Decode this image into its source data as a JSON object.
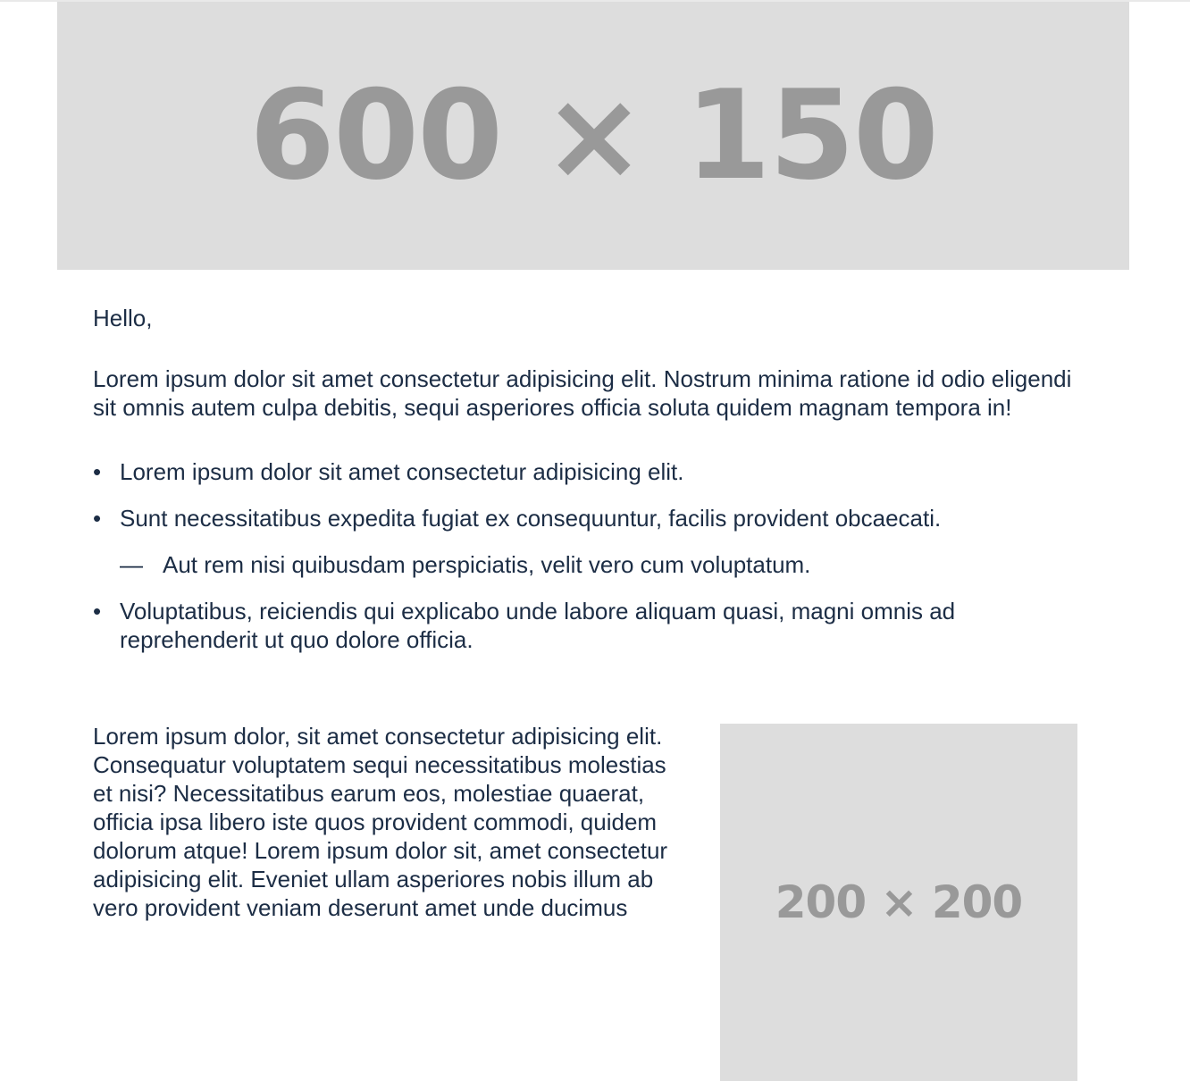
{
  "hero_image": {
    "placeholder_text": "600 × 150"
  },
  "email": {
    "greeting": "Hello,",
    "intro": "Lorem ipsum dolor sit amet consectetur adipisicing elit. Nostrum minima ratione id odio eligendi sit omnis autem culpa debitis, sequi asperiores officia soluta quidem magnam tempora in!",
    "list": [
      {
        "text": "Lorem ipsum dolor sit amet consectetur adipisicing elit."
      },
      {
        "text": "Sunt necessitatibus expedita fugiat ex consequuntur, facilis provident obcaecati.",
        "sub": [
          "Aut rem nisi quibusdam perspiciatis, velit vero cum voluptatum."
        ]
      },
      {
        "text": "Voluptatibus, reiciendis qui explicabo unde labore aliquam quasi, magni omnis ad reprehenderit ut quo dolore officia."
      }
    ],
    "split_text": "Lorem ipsum dolor, sit amet consectetur adipisicing elit. Consequatur voluptatem sequi necessitatibus molestias et nisi? Necessitatibus earum eos, molestiae quaerat, officia ipsa libero iste quos provident commodi, quidem dolorum atque! Lorem ipsum dolor sit, amet consectetur adipisicing elit. Eveniet ullam asperiores nobis illum ab vero provident veniam deserunt amet unde ducimus"
  },
  "thumb_image": {
    "placeholder_text": "200 × 200"
  },
  "colors": {
    "text": "#1c2d45",
    "placeholder_bg": "#dddddd",
    "placeholder_text": "#999999"
  }
}
